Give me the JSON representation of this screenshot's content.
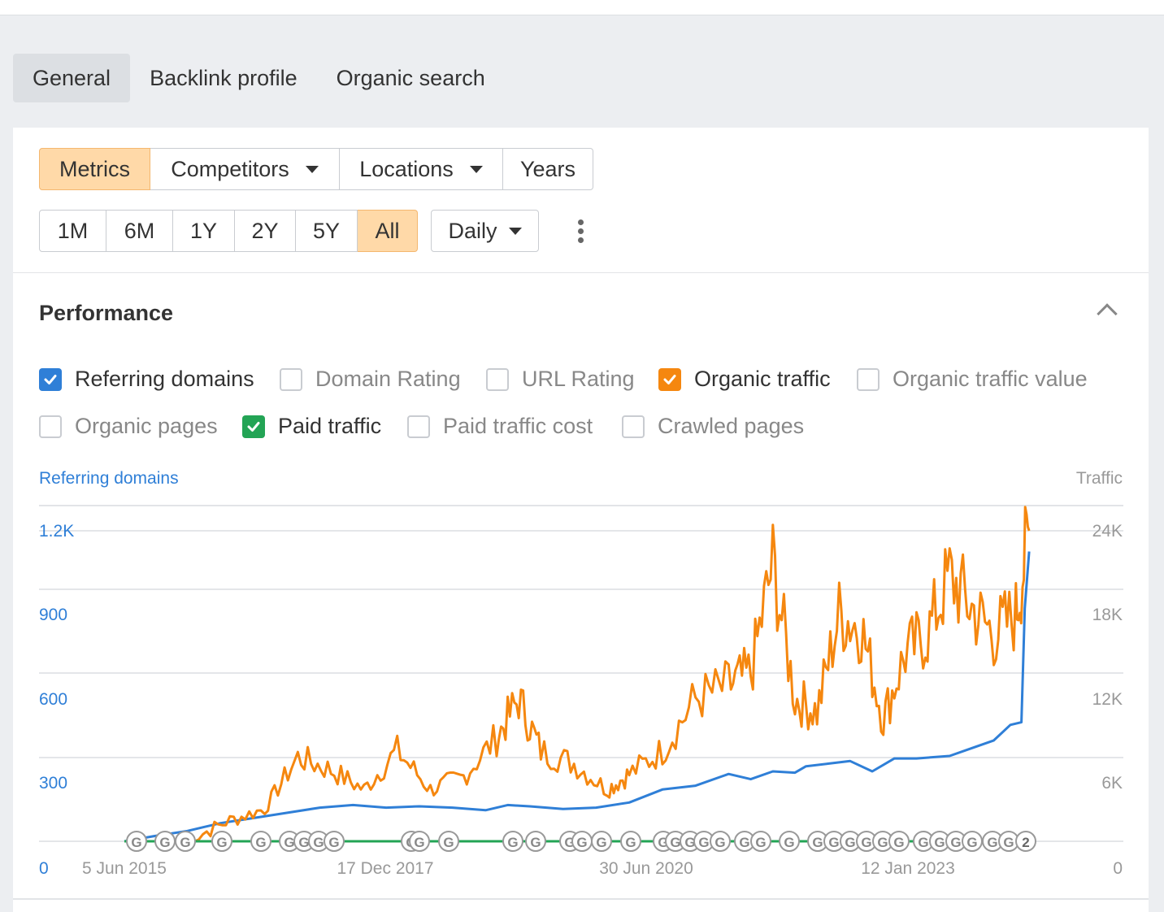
{
  "tabs": [
    {
      "label": "General",
      "active": true
    },
    {
      "label": "Backlink profile",
      "active": false
    },
    {
      "label": "Organic search",
      "active": false
    }
  ],
  "toolbar": {
    "view_buttons": [
      {
        "label": "Metrics",
        "active": true
      },
      {
        "label": "Competitors",
        "dropdown": true
      },
      {
        "label": "Locations",
        "dropdown": true
      },
      {
        "label": "Years"
      }
    ],
    "range_buttons": [
      {
        "label": "1M"
      },
      {
        "label": "6M"
      },
      {
        "label": "1Y"
      },
      {
        "label": "2Y"
      },
      {
        "label": "5Y"
      },
      {
        "label": "All",
        "active": true
      }
    ],
    "interval_select": "Daily"
  },
  "performance": {
    "title": "Performance",
    "metrics": [
      {
        "label": "Referring domains",
        "checked": true,
        "color": "#2f7fd7"
      },
      {
        "label": "Domain Rating",
        "checked": false
      },
      {
        "label": "URL Rating",
        "checked": false
      },
      {
        "label": "Organic traffic",
        "checked": true,
        "color": "#f5870f"
      },
      {
        "label": "Organic traffic value",
        "checked": false
      },
      {
        "label": "Organic pages",
        "checked": false
      },
      {
        "label": "Paid traffic",
        "checked": true,
        "color": "#23a455"
      },
      {
        "label": "Paid traffic cost",
        "checked": false
      },
      {
        "label": "Crawled pages",
        "checked": false
      }
    ]
  },
  "colors": {
    "accent": "#ffd9a8",
    "referring_domains": "#2f7fd7",
    "organic_traffic": "#f5870f",
    "paid_traffic": "#23a455"
  },
  "chart_data": {
    "type": "line",
    "left_axis_label": "Referring domains",
    "right_axis_label": "Traffic",
    "left_ticks": [
      "0",
      "300",
      "600",
      "900",
      "1.2K"
    ],
    "right_ticks": [
      "0",
      "6K",
      "12K",
      "18K",
      "24K"
    ],
    "x_ticks": [
      "5 Jun 2015",
      "17 Dec 2017",
      "30 Jun 2020",
      "12 Jan 2023"
    ],
    "ylim_left": [
      0,
      1200
    ],
    "ylim_right": [
      0,
      24000
    ],
    "xlim": [
      2015.43,
      2023.7
    ],
    "grid": true,
    "series": [
      {
        "name": "Referring domains",
        "axis": "left",
        "color": "#2f7fd7",
        "x": [
          2015.43,
          2015.7,
          2016.0,
          2016.3,
          2016.6,
          2016.9,
          2017.2,
          2017.5,
          2017.8,
          2018.1,
          2018.4,
          2018.7,
          2018.9,
          2019.1,
          2019.4,
          2019.7,
          2020.0,
          2020.3,
          2020.6,
          2020.9,
          2021.1,
          2021.3,
          2021.5,
          2021.6,
          2021.8,
          2022.0,
          2022.2,
          2022.4,
          2022.6,
          2022.9,
          2023.1,
          2023.3,
          2023.45,
          2023.55,
          2023.58,
          2023.62
        ],
        "y": [
          0,
          20,
          40,
          70,
          90,
          110,
          130,
          140,
          130,
          135,
          130,
          120,
          140,
          135,
          125,
          130,
          150,
          200,
          215,
          260,
          240,
          270,
          265,
          290,
          300,
          310,
          270,
          320,
          320,
          330,
          360,
          390,
          450,
          460,
          900,
          1120
        ]
      },
      {
        "name": "Organic traffic",
        "axis": "right",
        "color": "#f5870f",
        "x": [
          2016.0,
          2016.35,
          2016.7,
          2017.0,
          2017.3,
          2017.6,
          2017.9,
          2018.2,
          2018.5,
          2018.8,
          2019.0,
          2019.2,
          2019.5,
          2019.8,
          2020.0,
          2020.3,
          2020.6,
          2020.9,
          2021.1,
          2021.3,
          2021.5,
          2021.7,
          2021.9,
          2022.1,
          2022.3,
          2022.5,
          2022.7,
          2022.9,
          2023.1,
          2023.3,
          2023.5,
          2023.62
        ],
        "y": [
          0,
          1500,
          2500,
          6500,
          5500,
          4000,
          7000,
          4000,
          5000,
          8000,
          11000,
          7000,
          6000,
          4000,
          5200,
          7000,
          11000,
          12000,
          13000,
          21500,
          11000,
          10000,
          17500,
          16500,
          9500,
          14500,
          16000,
          20500,
          18000,
          16000,
          17500,
          24000
        ]
      },
      {
        "name": "Paid traffic",
        "axis": "right",
        "color": "#23a455",
        "x": [
          2015.43,
          2023.62
        ],
        "y": [
          0,
          0
        ]
      }
    ],
    "markers": [
      "G",
      "2"
    ]
  }
}
